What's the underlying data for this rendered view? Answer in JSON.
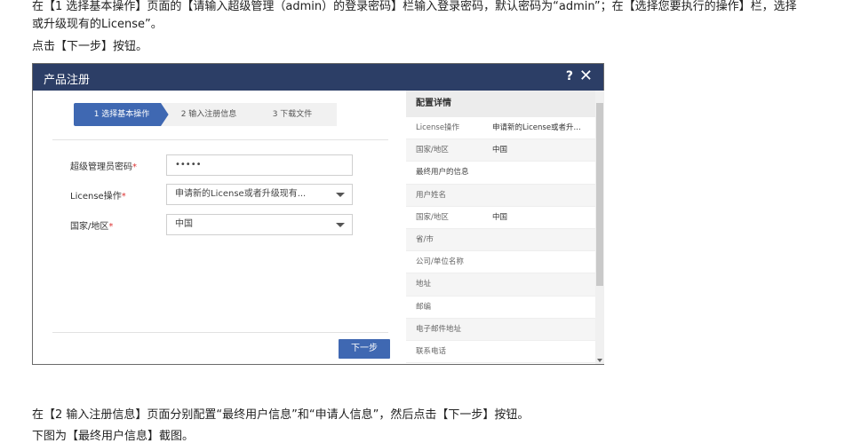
{
  "doc": {
    "line_top1": "在【1 选择基本操作】页面的【请输入超级管理（admin）的登录密码】栏输入登录密码，默认密码为“admin”；在【选择您要执行的操作】栏，选择",
    "line_top2": "或升级现有的License”。",
    "line_top3": "点击【下一步】按钮。",
    "line_bottom1": "在【2 输入注册信息】页面分别配置“最终用户信息”和“申请人信息”，然后点击【下一步】按钮。",
    "line_bottom2": "下图为【最终用户信息】截图。"
  },
  "dialog": {
    "title": "产品注册",
    "help_icon": "?",
    "close_icon": "✕",
    "steps": [
      {
        "label": "1 选择基本操作",
        "active": true
      },
      {
        "label": "2 输入注册信息",
        "active": false
      },
      {
        "label": "3 下载文件",
        "active": false
      }
    ],
    "form": {
      "password_label": "超级管理员密码",
      "password_value": "•••••",
      "license_label": "License操作",
      "license_value": "申请新的License或者升级现有...",
      "country_label": "国家/地区",
      "country_value": "中国",
      "required_mark": "*"
    },
    "next_button": "下一步",
    "details": {
      "header": "配置详情",
      "rows": [
        {
          "key": "License操作",
          "value": "申请新的License或者升..."
        },
        {
          "key": "国家/地区",
          "value": "中国"
        },
        {
          "key": "最终用户的信息",
          "value": ""
        },
        {
          "key": "用户姓名",
          "value": ""
        },
        {
          "key": "国家/地区",
          "value": "中国"
        },
        {
          "key": "省/市",
          "value": ""
        },
        {
          "key": "公司/单位名称",
          "value": ""
        },
        {
          "key": "地址",
          "value": ""
        },
        {
          "key": "邮编",
          "value": ""
        },
        {
          "key": "电子邮件地址",
          "value": ""
        },
        {
          "key": "联系电话",
          "value": ""
        }
      ]
    }
  },
  "colors": {
    "titlebar": "#2c3e66",
    "accent": "#3f68b2"
  }
}
